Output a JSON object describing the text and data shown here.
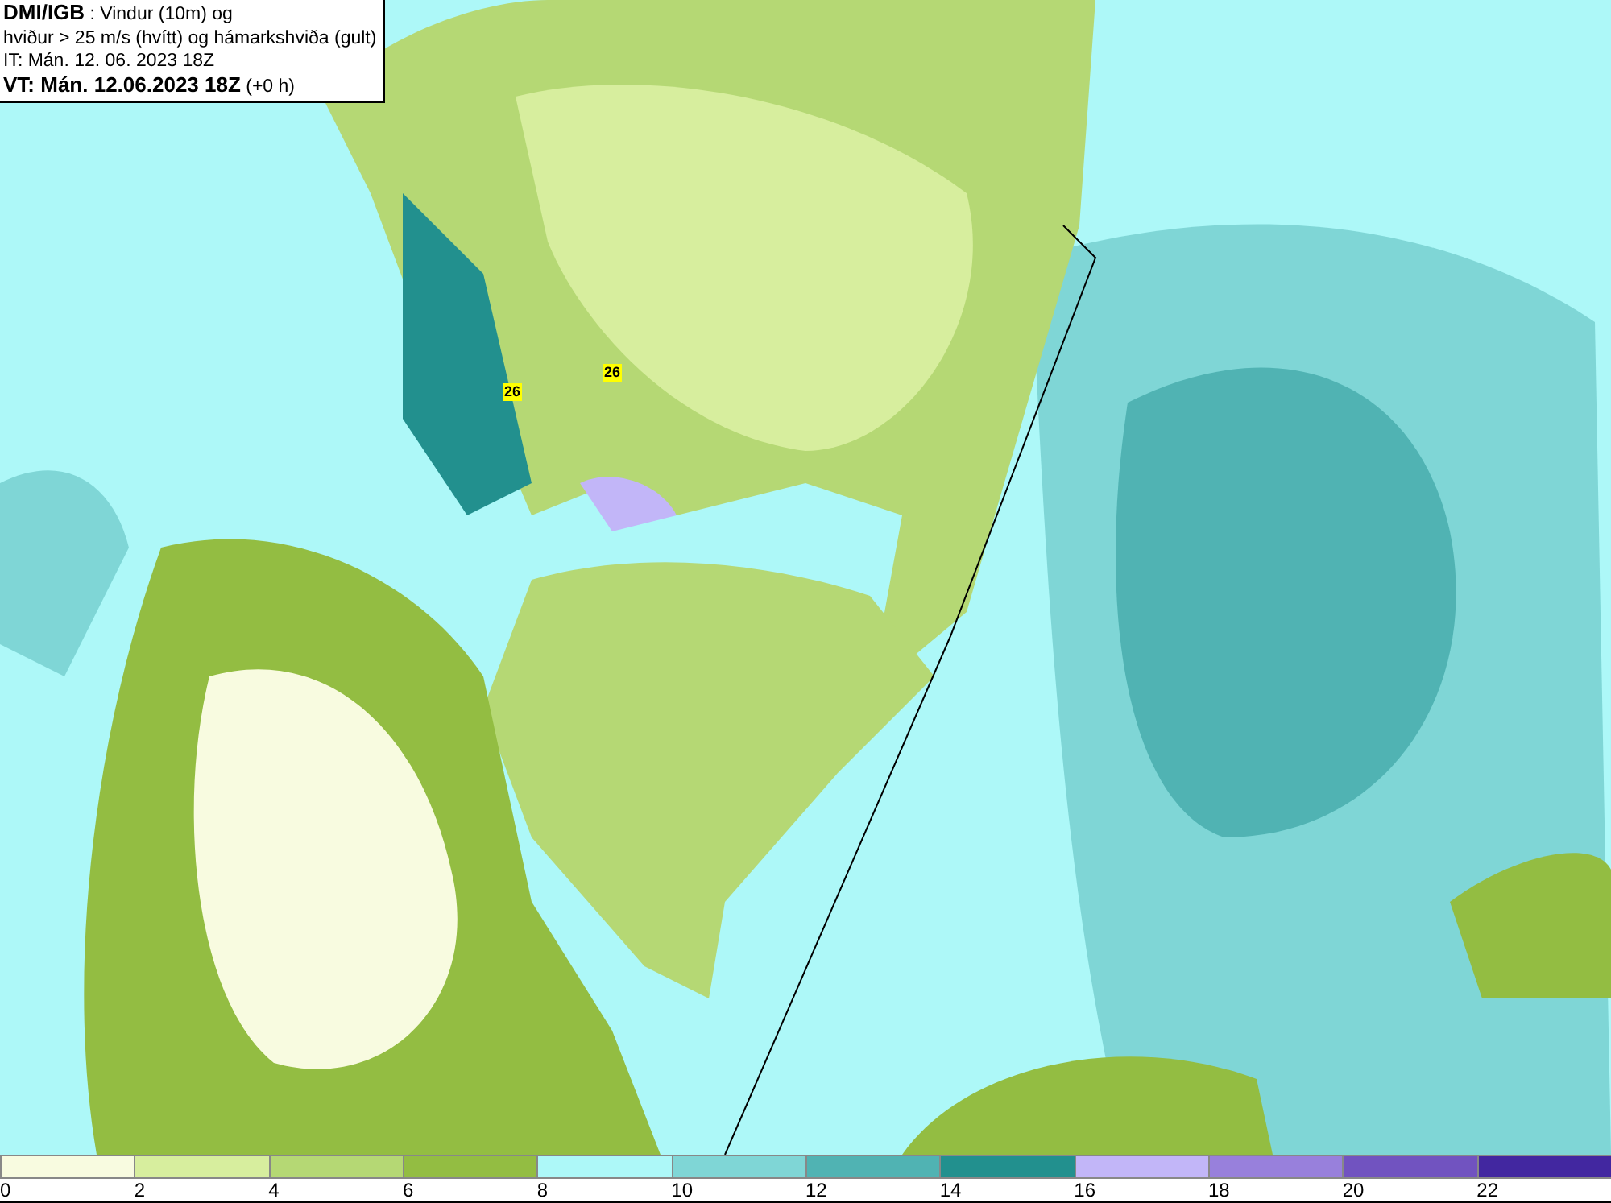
{
  "header": {
    "lines": [
      "**DMI/IGB** : Vindur (10m) og",
      "hviður > 25 m/s (hvítt) og hámarkshviða (gult)",
      "IT: Mán. 12. 06. 2023 18Z",
      "**VT: Mán. 12.06.2023 18Z** (+0 h)"
    ]
  },
  "map": {
    "gust_labels": [
      {
        "label": "26"
      },
      {
        "label": "26"
      }
    ]
  },
  "legend": {
    "bins": [
      {
        "color": "#f8fbe0"
      },
      {
        "color": "#d7ee9e"
      },
      {
        "color": "#b5d874"
      },
      {
        "color": "#93bd42"
      },
      {
        "color": "#adf8f8"
      },
      {
        "color": "#7fd6d6"
      },
      {
        "color": "#50b3b3"
      },
      {
        "color": "#22908e"
      },
      {
        "color": "#c2b6f8"
      },
      {
        "color": "#9880dc"
      },
      {
        "color": "#7153c0"
      },
      {
        "color": "#4227a0"
      }
    ],
    "ticks": [
      "0",
      "2",
      "4",
      "6",
      "8",
      "10",
      "12",
      "14",
      "16",
      "18",
      "20",
      "22"
    ]
  }
}
